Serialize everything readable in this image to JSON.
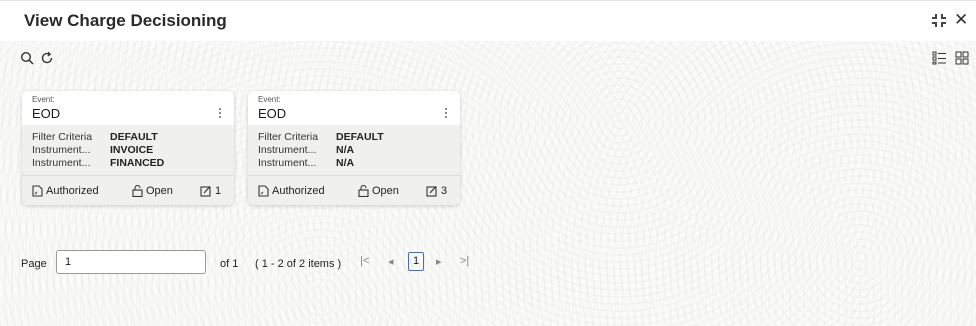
{
  "window": {
    "title": "View Charge Decisioning"
  },
  "icons": {
    "search": "search-icon",
    "refresh": "refresh-icon",
    "list_view": "list-view-icon",
    "grid_view": "grid-view-icon",
    "minimize": "minimize-icon",
    "close": "close-icon",
    "more": "kebab-menu-icon",
    "authorized": "document-icon",
    "open": "unlock-icon",
    "edit": "edit-icon"
  },
  "cards": [
    {
      "event_label": "Event:",
      "event_value": "EOD",
      "fields": [
        {
          "key": "Filter Criteria",
          "value": "DEFAULT"
        },
        {
          "key": "Instrument...",
          "value": "INVOICE"
        },
        {
          "key": "Instrument...",
          "value": "FINANCED"
        }
      ],
      "status": "Authorized",
      "lock": "Open",
      "mod_count": "1"
    },
    {
      "event_label": "Event:",
      "event_value": "EOD",
      "fields": [
        {
          "key": "Filter Criteria",
          "value": "DEFAULT"
        },
        {
          "key": "Instrument...",
          "value": "N/A"
        },
        {
          "key": "Instrument...",
          "value": "N/A"
        }
      ],
      "status": "Authorized",
      "lock": "Open",
      "mod_count": "3"
    }
  ],
  "pagination": {
    "page_label": "Page",
    "page_value": "1",
    "of_text": "of 1",
    "items_text": "( 1 - 2 of 2 items )",
    "current_page": "1",
    "first_symbol": "|<",
    "prev_symbol": "◂",
    "next_symbol": "▸",
    "last_symbol": ">|"
  }
}
